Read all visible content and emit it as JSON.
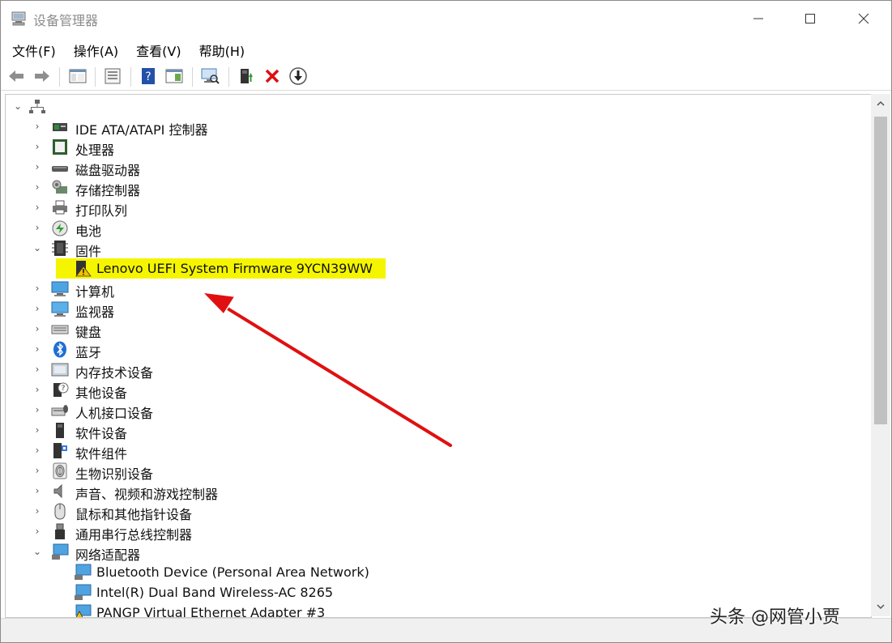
{
  "window": {
    "title": "设备管理器"
  },
  "menu": [
    "文件(F)",
    "操作(A)",
    "查看(V)",
    "帮助(H)"
  ],
  "toolbar": {
    "buttons": [
      "back-icon",
      "forward-icon",
      "show-hide-tree-icon",
      "properties-icon",
      "help-icon",
      "action-pane-icon",
      "scan-hardware-icon",
      "update-driver-icon",
      "uninstall-icon",
      "disable-icon"
    ]
  },
  "tree": {
    "root": "",
    "categories": [
      {
        "label": "IDE ATA/ATAPI 控制器",
        "expanded": false,
        "icon": "ide-controller-icon"
      },
      {
        "label": "处理器",
        "expanded": false,
        "icon": "processor-icon"
      },
      {
        "label": "磁盘驱动器",
        "expanded": false,
        "icon": "disk-drive-icon"
      },
      {
        "label": "存储控制器",
        "expanded": false,
        "icon": "storage-controller-icon"
      },
      {
        "label": "打印队列",
        "expanded": false,
        "icon": "printer-icon"
      },
      {
        "label": "电池",
        "expanded": false,
        "icon": "battery-icon"
      },
      {
        "label": "固件",
        "expanded": true,
        "icon": "firmware-icon",
        "children": [
          {
            "label": "Lenovo UEFI System Firmware 9YCN39WW",
            "icon": "warning-device-icon",
            "highlighted": true
          }
        ]
      },
      {
        "label": "计算机",
        "expanded": false,
        "icon": "computer-icon"
      },
      {
        "label": "监视器",
        "expanded": false,
        "icon": "monitor-icon"
      },
      {
        "label": "键盘",
        "expanded": false,
        "icon": "keyboard-icon"
      },
      {
        "label": "蓝牙",
        "expanded": false,
        "icon": "bluetooth-icon"
      },
      {
        "label": "内存技术设备",
        "expanded": false,
        "icon": "memory-device-icon"
      },
      {
        "label": "其他设备",
        "expanded": false,
        "icon": "other-device-icon"
      },
      {
        "label": "人机接口设备",
        "expanded": false,
        "icon": "hid-icon"
      },
      {
        "label": "软件设备",
        "expanded": false,
        "icon": "software-device-icon"
      },
      {
        "label": "软件组件",
        "expanded": false,
        "icon": "software-component-icon"
      },
      {
        "label": "生物识别设备",
        "expanded": false,
        "icon": "fingerprint-icon"
      },
      {
        "label": "声音、视频和游戏控制器",
        "expanded": false,
        "icon": "speaker-icon"
      },
      {
        "label": "鼠标和其他指针设备",
        "expanded": false,
        "icon": "mouse-icon"
      },
      {
        "label": "通用串行总线控制器",
        "expanded": false,
        "icon": "usb-icon"
      },
      {
        "label": "网络适配器",
        "expanded": true,
        "icon": "network-adapter-icon",
        "children": [
          {
            "label": "Bluetooth Device (Personal Area Network)",
            "icon": "network-adapter-icon"
          },
          {
            "label": "Intel(R) Dual Band Wireless-AC 8265",
            "icon": "network-adapter-icon"
          },
          {
            "label": "PANGP Virtual Ethernet Adapter #3",
            "icon": "network-adapter-warning-icon"
          }
        ]
      }
    ]
  },
  "watermark": "头条 @网管小贾",
  "colors": {
    "highlight": "#f5f500",
    "arrow": "#e01010"
  }
}
